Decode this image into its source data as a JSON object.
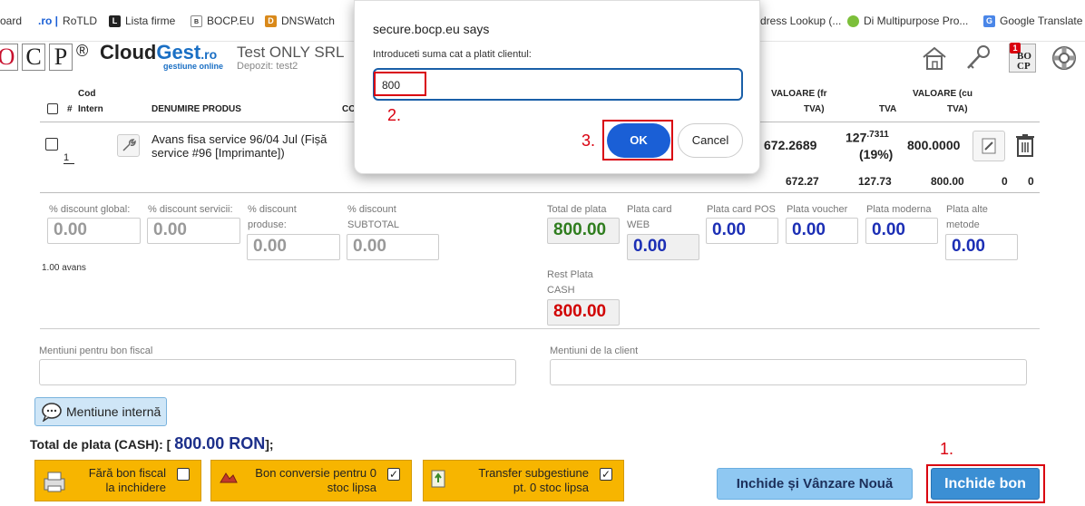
{
  "bookmarks": [
    {
      "label": "oard",
      "icon": "page-icon"
    },
    {
      "label": "RoTLD",
      "prefix": ".ro |",
      "icon": "ro-icon"
    },
    {
      "label": "Lista firme",
      "icon": "lista-firme-icon"
    },
    {
      "label": "BOCP.EU",
      "icon": "bocp-icon"
    },
    {
      "label": "DNSWatch",
      "icon": "dnswatch-icon"
    },
    {
      "label": "dress Lookup (...",
      "icon": "globe-icon"
    },
    {
      "label": "Di Multipurpose Pro...",
      "icon": "green-dot-icon"
    },
    {
      "label": "Google Translate",
      "icon": "google-translate-icon"
    }
  ],
  "header": {
    "logo_letters": [
      "O",
      "C",
      "P"
    ],
    "registered": "®",
    "brand_cloud": "Cloud",
    "brand_gest": "Gest",
    "brand_ro": ".ro",
    "brand_tagline": "gestiune online",
    "company": "Test ONLY SRL",
    "depot": "Depozit: test2",
    "badge_count": "1",
    "badge_text_top": "BO",
    "badge_text_bottom": "CP"
  },
  "table": {
    "headers": {
      "num": "#",
      "cod": "Cod",
      "intern": "Intern",
      "denumire": "DENUMIRE PRODUS",
      "co": "CO",
      "valoare_fr": "VALOARE (fr",
      "valoare_fr2": "TVA)",
      "tva": "TVA",
      "valoare_cu": "VALOARE (cu",
      "valoare_cu2": "TVA)"
    },
    "row": {
      "index": "1",
      "name": "Avans fisa service 96/04 Jul (Fișă service #96 [Imprimante])",
      "valoare_fr": "672.2689",
      "tva_main": "127",
      "tva_sup": ".7311",
      "tva_pct": "(19%)",
      "valoare_cu": "800.0000"
    },
    "totals": {
      "valoare_fr": "672.27",
      "tva": "127.73",
      "valoare_cu": "800.00",
      "z1": "0",
      "z2": "0"
    }
  },
  "discounts": {
    "global_label": "% discount global:",
    "global_value": "0.00",
    "servicii_label": "% discount servicii:",
    "servicii_value": "0.00",
    "produse_label1": "% discount",
    "produse_label2": "produse:",
    "produse_value": "0.00",
    "subtotal_label1": "% discount",
    "subtotal_label2": "SUBTOTAL",
    "subtotal_value": "0.00",
    "avans_note": "1.00 avans"
  },
  "payments": {
    "total_label": "Total de plata",
    "total_value": "800.00",
    "card_web_label1": "Plata card",
    "card_web_label2": "WEB",
    "card_web_value": "0.00",
    "card_pos_label": "Plata card POS",
    "card_pos_value": "0.00",
    "voucher_label": "Plata voucher",
    "voucher_value": "0.00",
    "moderna_label": "Plata moderna",
    "moderna_value": "0.00",
    "alte_label1": "Plata alte",
    "alte_label2": "metode",
    "alte_value": "0.00",
    "rest_label1": "Rest Plata",
    "rest_label2": "CASH",
    "rest_value": "800.00"
  },
  "mentions": {
    "bon_label": "Mentiuni pentru bon fiscal",
    "bon_value": "",
    "client_label": "Mentiuni de la client",
    "client_value": "",
    "internal_button": "Mentiune internă"
  },
  "footer": {
    "total_prefix": "Total de plata (CASH): [",
    "total_amount": "800.00 RON",
    "total_suffix": "];",
    "opt1_line1": "Fără bon fiscal",
    "opt1_line2": "la inchidere",
    "opt1_checked": false,
    "opt2_line1": "Bon conversie pentru 0",
    "opt2_line2": "stoc lipsa",
    "opt2_checked": true,
    "opt3_line1": "Transfer subgestiune",
    "opt3_line2": "pt. 0 stoc lipsa",
    "opt3_checked": true,
    "btn_close_new": "Inchide și Vânzare Nouă",
    "btn_close": "Inchide bon"
  },
  "dialog": {
    "title": "secure.bocp.eu says",
    "message": "Introduceti suma cat a platit clientul:",
    "input_value": "800",
    "ok": "OK",
    "cancel": "Cancel"
  },
  "annotations": {
    "step1": "1.",
    "step2": "2.",
    "step3": "3."
  },
  "colors": {
    "ok_button": "#1a5fd6",
    "close_button": "#3b8fd4",
    "close_new_button": "#8fc8f2",
    "option_bg": "#f7b500",
    "annotation": "#d9000f",
    "total_green": "#2f7d1e",
    "rest_red": "#d10000",
    "value_blue": "#1c2fb5"
  }
}
